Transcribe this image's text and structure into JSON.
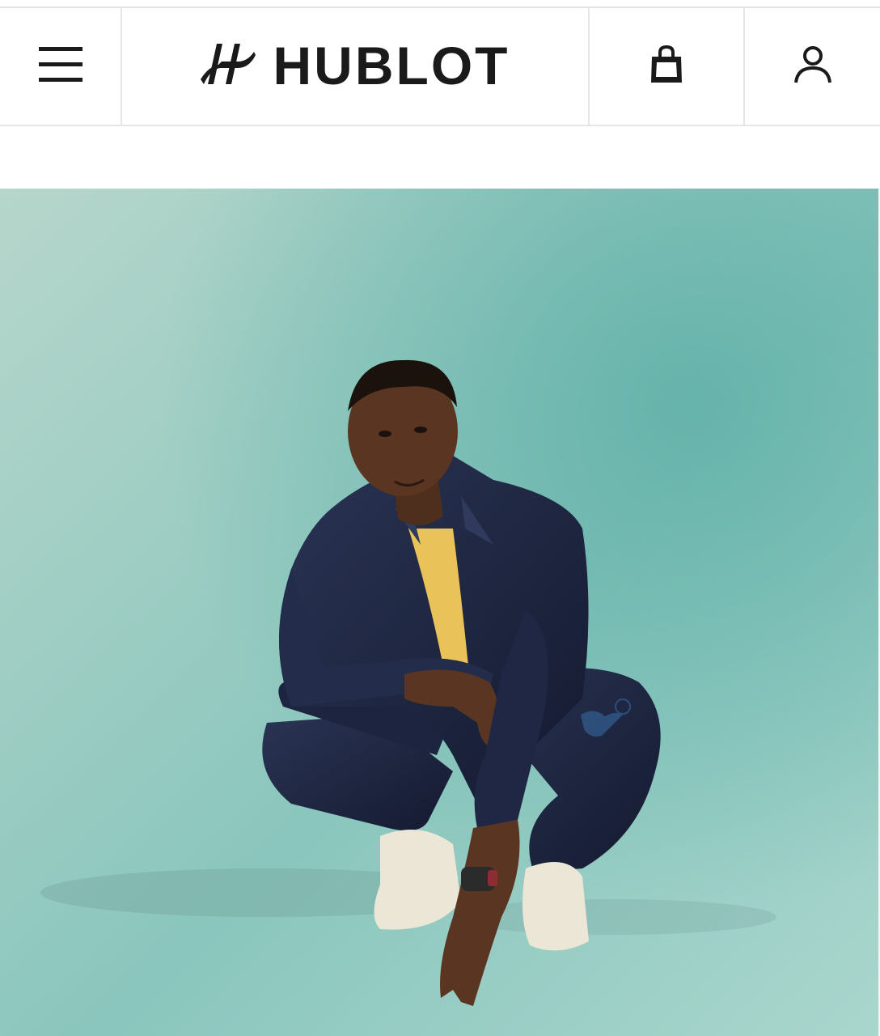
{
  "header": {
    "brand": "HUBLOT",
    "menu_icon": "hamburger-menu-icon",
    "brand_mark_icon": "hublot-h-mark-icon",
    "bag_icon": "shopping-bag-icon",
    "account_icon": "user-account-icon"
  },
  "hero": {
    "image": "campaign-photo-man-crouching-denim-watch",
    "watermark_icon": "bird-watermark-icon",
    "background_color": "#86c4bc"
  },
  "colors": {
    "ink": "#1a1a1a",
    "divider": "#e6e6e6",
    "teal": "#7dbfb6"
  }
}
